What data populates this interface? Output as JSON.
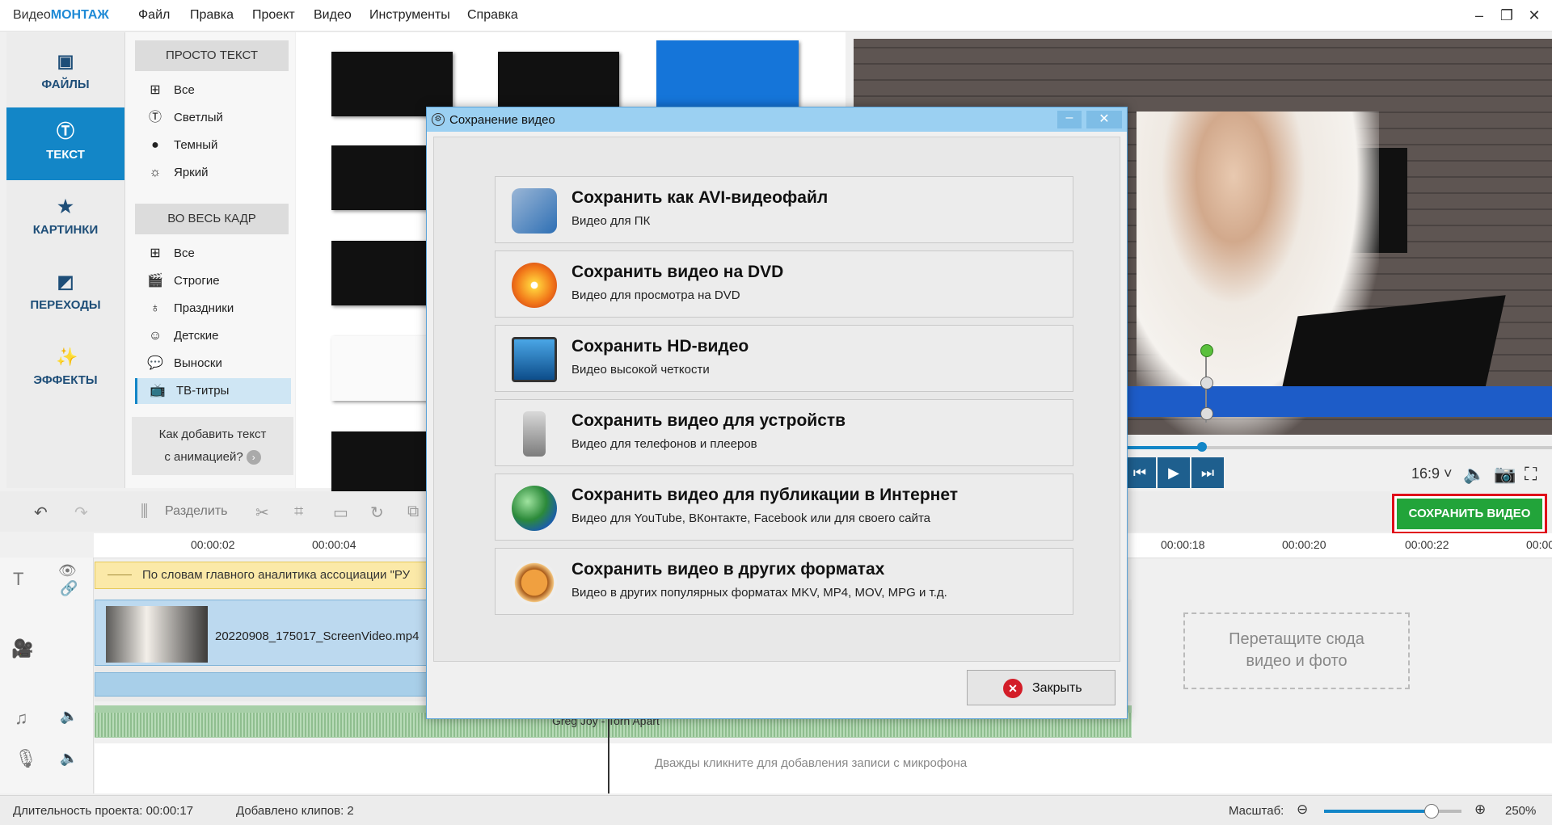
{
  "app": {
    "logo_prefix": "Видео",
    "logo_suffix": "МОНТАЖ",
    "menu": [
      "Файл",
      "Правка",
      "Проект",
      "Видео",
      "Инструменты",
      "Справка"
    ]
  },
  "leftnav": {
    "items": [
      {
        "label": "ФАЙЛЫ",
        "icon": "image-icon"
      },
      {
        "label": "ТЕКСТ",
        "icon": "text-icon",
        "active": true
      },
      {
        "label": "КАРТИНКИ",
        "icon": "star-icon"
      },
      {
        "label": "ПЕРЕХОДЫ",
        "icon": "transitions-icon"
      },
      {
        "label": "ЭФФЕКТЫ",
        "icon": "magic-wand-icon"
      }
    ]
  },
  "categories": {
    "group1_title": "ПРОСТО ТЕКСТ",
    "group1": [
      "Все",
      "Светлый",
      "Темный",
      "Яркий"
    ],
    "group2_title": "ВО ВЕСЬ КАДР",
    "group2": [
      "Все",
      "Строгие",
      "Праздники",
      "Детские",
      "Выноски",
      "ТВ-титры"
    ],
    "selected": "ТВ-титры",
    "howto_line1": "Как добавить текст",
    "howto_line2": "с анимацией?"
  },
  "player": {
    "aspect": "16:9 ˅"
  },
  "save_video_button": "СОХРАНИТЬ ВИДЕО",
  "toolbar": {
    "split_label": "Разделить"
  },
  "timeline": {
    "ticks": [
      "00:00:02",
      "00:00:04",
      "00:00:18",
      "00:00:20",
      "00:00:22",
      "00:00"
    ],
    "text_clip": "По словам главного аналитика ассоциации \"РУ",
    "video_clip_name": "20220908_175017_ScreenVideo.mp4",
    "dropzone_line1": "Перетащите сюда",
    "dropzone_line2": "видео и фото",
    "audio_label": "Greg Joy - Torn Apart",
    "mic_hint": "Дважды кликните для добавления записи с микрофона"
  },
  "status": {
    "duration": "Длительность проекта:  00:00:17",
    "clips": "Добавлено клипов: 2",
    "zoom_label": "Масштаб:",
    "zoom_value": "250%"
  },
  "dialog": {
    "title": "Сохранение видео",
    "options": [
      {
        "title": "Сохранить как AVI-видеофайл",
        "subtitle": "Видео для ПК",
        "icon": "film-music-icon"
      },
      {
        "title": "Сохранить видео на DVD",
        "subtitle": "Видео для просмотра на DVD",
        "icon": "dvd-disc-icon"
      },
      {
        "title": "Сохранить HD-видео",
        "subtitle": "Видео высокой четкости",
        "icon": "monitor-icon"
      },
      {
        "title": "Сохранить видео для устройств",
        "subtitle": "Видео для телефонов и плееров",
        "icon": "phone-icon"
      },
      {
        "title": "Сохранить видео для публикации в Интернет",
        "subtitle": "Видео для YouTube, ВКонтакте, Facebook или для своего сайта",
        "icon": "globe-icon"
      },
      {
        "title": "Сохранить видео в других форматах",
        "subtitle": "Видео в других популярных форматах MKV, MP4, MOV, MPG и т.д.",
        "icon": "film-reel-icon"
      }
    ],
    "close_label": "Закрыть"
  }
}
